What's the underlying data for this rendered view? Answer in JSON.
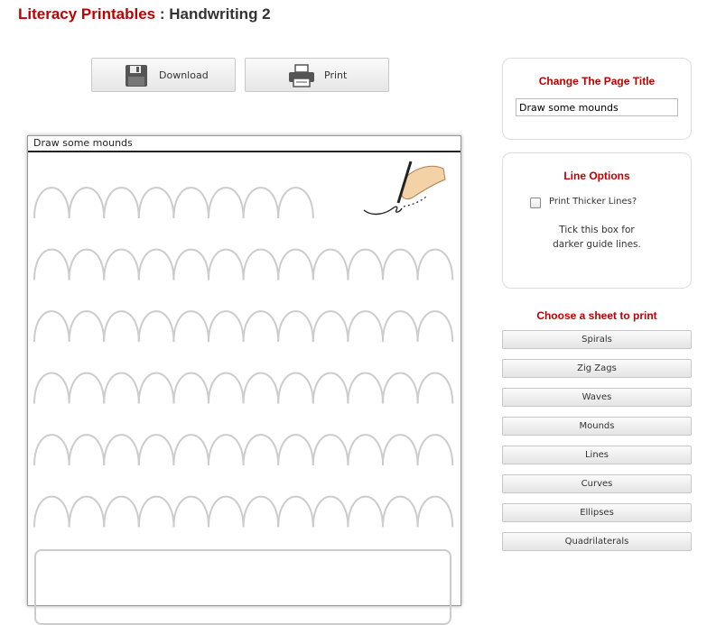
{
  "header": {
    "brand": "Literacy Printables",
    "separator": " : ",
    "page": "Handwriting 2"
  },
  "toolbar": {
    "download_label": "Download",
    "print_label": "Print",
    "download_icon": "floppy-disk-icon",
    "print_icon": "printer-icon"
  },
  "sheet": {
    "title": "Draw some mounds",
    "decoration_icon": "hand-writing-icon",
    "rows": [
      {
        "mounds": 8
      },
      {
        "mounds": 12
      },
      {
        "mounds": 12
      },
      {
        "mounds": 12
      },
      {
        "mounds": 12
      },
      {
        "mounds": 12
      }
    ]
  },
  "title_panel": {
    "heading": "Change The Page Title",
    "value": "Draw some mounds"
  },
  "line_panel": {
    "heading": "Line Options",
    "checkbox_label": "Print Thicker Lines?",
    "checked": false,
    "help_line1": "Tick this box for",
    "help_line2": "darker guide lines."
  },
  "sheets_panel": {
    "heading": "Choose a sheet to print",
    "items": [
      "Spirals",
      "Zig Zags",
      "Waves",
      "Mounds",
      "Lines",
      "Curves",
      "Ellipses",
      "Quadrilaterals"
    ]
  },
  "colors": {
    "brand": "#c00000",
    "guide_line": "#cccccc"
  }
}
